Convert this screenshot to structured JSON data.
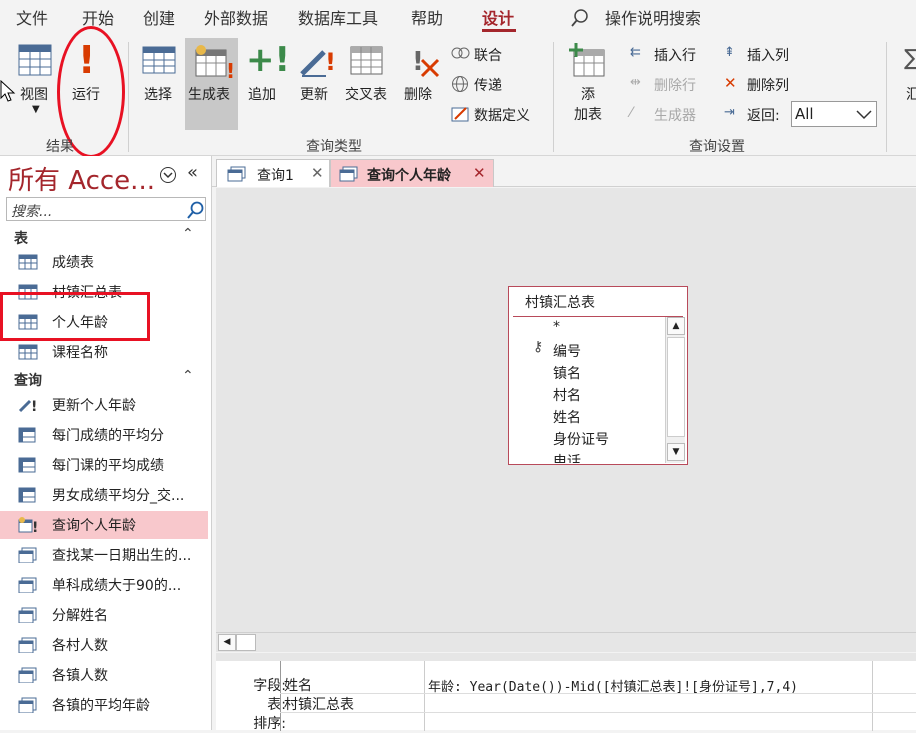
{
  "menu": {
    "items": [
      "文件",
      "开始",
      "创建",
      "外部数据",
      "数据库工具",
      "帮助",
      "设计"
    ],
    "active": "设计",
    "tell_me": "操作说明搜索"
  },
  "ribbon": {
    "results": {
      "view": "视图",
      "run": "运行",
      "group": "结果"
    },
    "query_type": {
      "select": "选择",
      "make_table": "生成表",
      "append": "追加",
      "update": "更新",
      "crosstab": "交叉表",
      "delete": "删除",
      "union": "联合",
      "pass_through": "传递",
      "data_definition": "数据定义",
      "group": "查询类型"
    },
    "query_setup": {
      "show_table": "添\n加表",
      "show_table_l1": "添",
      "show_table_l2": "加表",
      "insert_row": "插入行",
      "delete_row": "删除行",
      "builder": "生成器",
      "insert_col": "插入列",
      "delete_col": "删除列",
      "return_label": "返回:",
      "return_value": "All",
      "group": "查询设置"
    },
    "overflow": "汇"
  },
  "nav": {
    "title": "所有 Acce...",
    "search_placeholder": "搜索...",
    "sections": [
      {
        "name": "表",
        "items": [
          "成绩表",
          "村镇汇总表",
          "个人年龄",
          "课程名称"
        ]
      },
      {
        "name": "查询",
        "items": [
          "更新个人年龄",
          "每门成绩的平均分",
          "每门课的平均成绩",
          "男女成绩平均分_交...",
          "查询个人年龄",
          "查找某一日期出生的...",
          "单科成绩大于90的...",
          "分解姓名",
          "各村人数",
          "各镇人数",
          "各镇的平均年龄"
        ]
      }
    ],
    "selected": "查询个人年龄"
  },
  "tabs": [
    {
      "label": "查询1",
      "active": false
    },
    {
      "label": "查询个人年龄",
      "active": true
    }
  ],
  "table_box": {
    "title": "村镇汇总表",
    "fields": [
      "*",
      "编号",
      "镇名",
      "村名",
      "姓名",
      "身份证号",
      "电话"
    ]
  },
  "qbe": {
    "row_labels": [
      "字段:",
      "表:",
      "排序:"
    ],
    "col1": {
      "field": "姓名",
      "table": "村镇汇总表"
    },
    "col2": {
      "field": "年龄: Year(Date())-Mid([村镇汇总表]![身份证号],7,4)",
      "table": ""
    }
  },
  "colors": {
    "accent": "#a4262c",
    "highlight": "#e81123",
    "selected_bg": "#f8c8cc"
  }
}
